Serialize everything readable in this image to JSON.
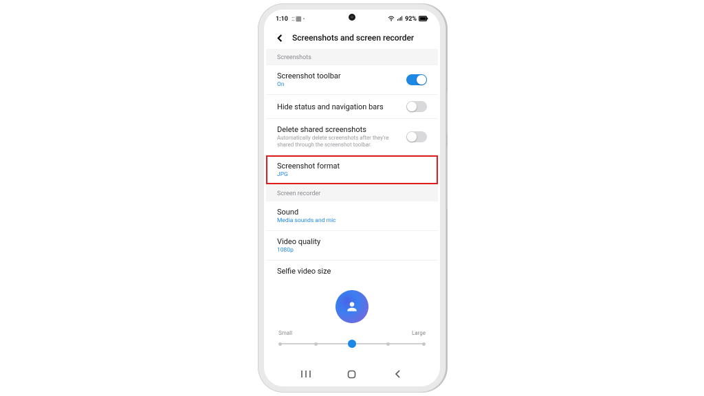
{
  "statusbar": {
    "time": "1:10",
    "indicators": "⁚⁚ ⬛ •",
    "battery_text": "92%"
  },
  "header": {
    "title": "Screenshots and screen recorder"
  },
  "sections": {
    "screenshots_title": "Screenshots",
    "recorder_title": "Screen recorder"
  },
  "rows": {
    "toolbar": {
      "label": "Screenshot toolbar",
      "sub": "On",
      "on": true
    },
    "hide_bars": {
      "label": "Hide status and navigation bars",
      "on": false
    },
    "delete_shared": {
      "label": "Delete shared screenshots",
      "desc": "Automatically delete screenshots after they're shared through the screenshot toolbar.",
      "on": false
    },
    "format": {
      "label": "Screenshot format",
      "sub": "JPG"
    },
    "sound": {
      "label": "Sound",
      "sub": "Media sounds and mic"
    },
    "video_quality": {
      "label": "Video quality",
      "sub": "1080p"
    },
    "selfie_size": {
      "label": "Selfie video size"
    }
  },
  "slider": {
    "small_label": "Small",
    "large_label": "Large",
    "steps": 5,
    "value_index": 2
  }
}
